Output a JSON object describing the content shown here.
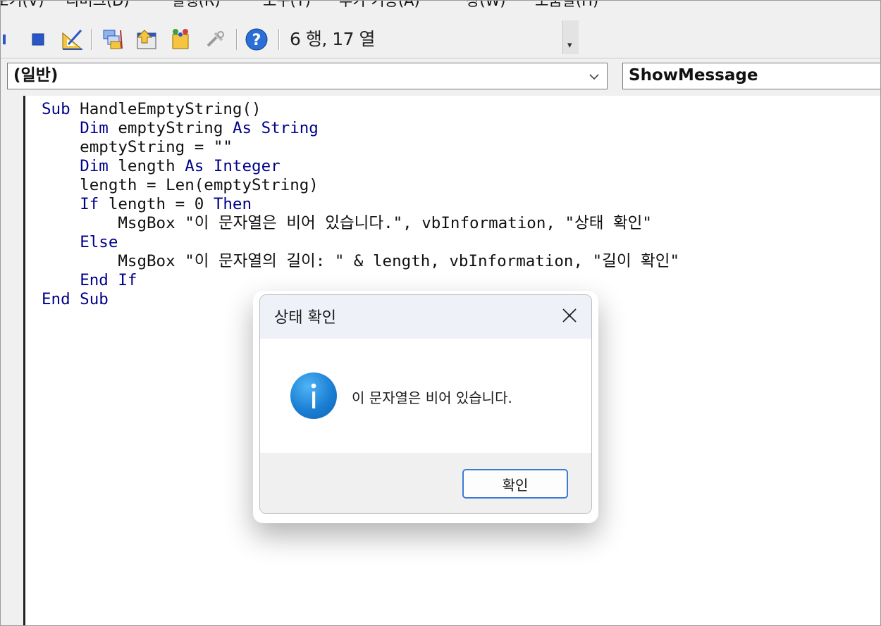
{
  "menu": {
    "items": [
      "보기(V)",
      "디버그(D)",
      "실행(R)",
      "도구(T)",
      "추가 기능(A)",
      "창(W)",
      "도움말(H)"
    ]
  },
  "toolbar": {
    "icons": [
      "pause-icon",
      "stop-icon",
      "design-mode-icon",
      "project-explorer-icon",
      "properties-icon",
      "object-browser-icon",
      "toolbox-icon",
      "help-icon"
    ],
    "status": "6 행, 17 열"
  },
  "editor": {
    "object_combo": "(일반)",
    "procedure_combo": "ShowMessage",
    "code_lines": [
      [
        {
          "k": true,
          "t": "Sub"
        },
        {
          "k": false,
          "t": " HandleEmptyString()"
        }
      ],
      [
        {
          "k": false,
          "t": "    "
        },
        {
          "k": true,
          "t": "Dim"
        },
        {
          "k": false,
          "t": " emptyString "
        },
        {
          "k": true,
          "t": "As String"
        }
      ],
      [
        {
          "k": false,
          "t": "    emptyString = \"\""
        }
      ],
      [
        {
          "k": false,
          "t": "    "
        },
        {
          "k": true,
          "t": "Dim"
        },
        {
          "k": false,
          "t": " length "
        },
        {
          "k": true,
          "t": "As Integer"
        }
      ],
      [
        {
          "k": false,
          "t": "    length = Len(emptyString)"
        }
      ],
      [
        {
          "k": false,
          "t": "    "
        },
        {
          "k": true,
          "t": "If"
        },
        {
          "k": false,
          "t": " length = 0 "
        },
        {
          "k": true,
          "t": "Then"
        }
      ],
      [
        {
          "k": false,
          "t": "        MsgBox \"이 문자열은 비어 있습니다.\", vbInformation, \"상태 확인\""
        }
      ],
      [
        {
          "k": false,
          "t": "    "
        },
        {
          "k": true,
          "t": "Else"
        }
      ],
      [
        {
          "k": false,
          "t": "        MsgBox \"이 문자열의 길이: \" & length, vbInformation, \"길이 확인\""
        }
      ],
      [
        {
          "k": false,
          "t": "    "
        },
        {
          "k": true,
          "t": "End If"
        }
      ],
      [
        {
          "k": true,
          "t": "End Sub"
        }
      ]
    ]
  },
  "dialog": {
    "title": "상태 확인",
    "message": "이 문자열은 비어 있습니다.",
    "ok_label": "확인",
    "icon": "info-icon",
    "accent": "#1b7fd4"
  }
}
